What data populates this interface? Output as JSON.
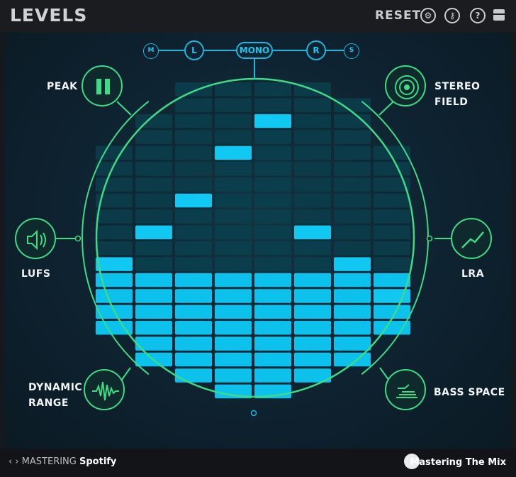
{
  "app": {
    "title": "LEVELS"
  },
  "toolbar": {
    "reset_label": "RESET",
    "icons": [
      "gear-icon",
      "key-icon",
      "help-icon",
      "window-icon"
    ]
  },
  "channels": {
    "m": "M",
    "l": "L",
    "mono": "MONO",
    "r": "R",
    "s": "S",
    "selected": "MONO"
  },
  "features": {
    "peak": "PEAK",
    "stereo_field": "STEREO FIELD",
    "lufs": "LUFS",
    "lra": "LRA",
    "dynamic_range_line1": "DYNAMIC",
    "dynamic_range_line2": "RANGE",
    "bass_space": "BASS SPACE"
  },
  "footer": {
    "mastering_prefix": "MASTERING",
    "preset": "Spotify",
    "brand": "Mastering The Mix"
  },
  "colors": {
    "accent_green": "#3ddc84",
    "accent_cyan": "#0fd0ff",
    "panel_bg": "#0e2230"
  },
  "meter": {
    "levels": [
      0.45,
      0.56,
      0.67,
      0.78,
      0.89,
      0.56,
      0.45,
      0.34
    ]
  }
}
